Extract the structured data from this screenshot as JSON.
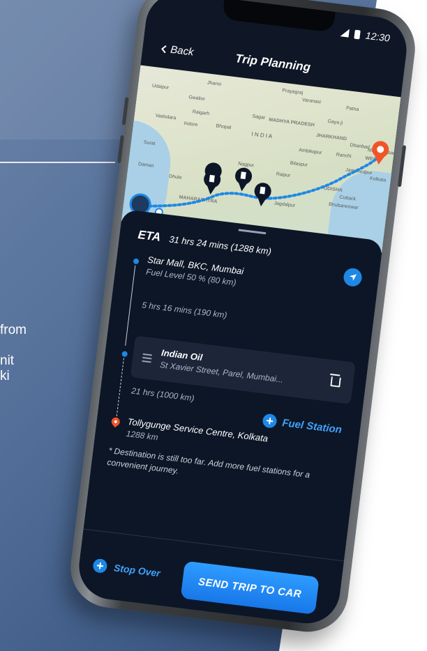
{
  "background": {
    "text_lines": [
      "from",
      "nit",
      "ki"
    ]
  },
  "status_bar": {
    "time": "12:30"
  },
  "header": {
    "back_label": "Back",
    "title": "Trip Planning"
  },
  "map": {
    "labels": [
      "Jhansi",
      "Prayagraj",
      "Varanasi",
      "Patna",
      "Udaipur",
      "Gwalior",
      "Gaya ji",
      "Raigarh",
      "Sagar",
      "MADHYA PRADESH",
      "JHARKHAND",
      "Dhanbad",
      "Vadodara",
      "Indore",
      "Bhopal",
      "I N D I A",
      "Ambikapur",
      "Ranchi",
      "Murshidabad",
      "WEST",
      "Jamshedpur",
      "Surat",
      "Nagpur",
      "Raipur",
      "Bilaspur",
      "ODISHA",
      "Kolkata",
      "Daman",
      "Dhule",
      "MAHARASHTRA",
      "Bhubaneswar",
      "Jagdalpur",
      "Cuttack"
    ]
  },
  "trip": {
    "eta_label": "ETA",
    "eta_value": "31 hrs 24 mins (1288 km)",
    "origin": {
      "name": "Star Mall, BKC, Mumbai",
      "detail": "Fuel Level 50 % (80 km)"
    },
    "leg1": "5 hrs 16 mins (190 km)",
    "stop": {
      "name": "Indian Oil",
      "address": "St Xavier Street, Parel, Mumbai..."
    },
    "leg2": "21 hrs (1000 km)",
    "add_fuel_label": "Fuel Station",
    "destination": {
      "name": "Tollygunge Service Centre, Kolkata",
      "distance": "1288 km"
    },
    "note": "* Destination is still too far. Add more fuel stations for a convenient journey."
  },
  "footer": {
    "stopover_label": "Stop Over",
    "send_label": "SEND TRIP TO CAR"
  },
  "colors": {
    "accent": "#1e88e5",
    "destination_pin": "#f0552a",
    "sheet_bg": "#0d1626"
  }
}
